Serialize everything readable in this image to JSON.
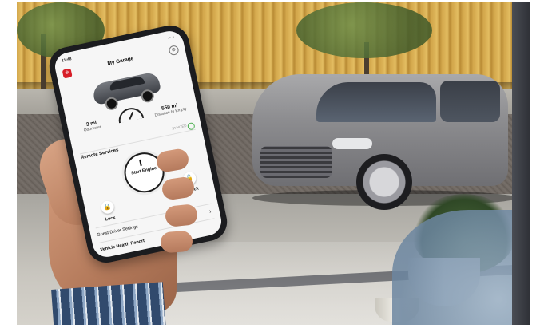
{
  "phone": {
    "status_time": "11:48",
    "status_icons": "▪▪ ◔",
    "app_title": "My Garage",
    "app_logo": "⊛",
    "stats": [
      {
        "value": "3 mi",
        "label": "Odometer"
      },
      {
        "value": "550 mi",
        "label": "Distance to Empty"
      }
    ],
    "sync_text": "SYNCED",
    "remote_services_label": "Remote Services",
    "start_engine_label": "Start Engine",
    "lock_label": "Lock",
    "unlock_label": "Unlock",
    "lock_icon": "🔒",
    "unlock_icon": "🔓",
    "guest_driver_label": "Guest Driver Settings",
    "vehicle_health_label": "Vehicle Health Report",
    "chevron": "›"
  },
  "icons": {
    "settings": "gear-icon",
    "power": "power-icon",
    "gauge": "fuel-gauge-icon"
  },
  "colors": {
    "brand_red": "#d71e28",
    "screen_bg": "#f6f6f6",
    "sync_green": "#4caf50"
  }
}
